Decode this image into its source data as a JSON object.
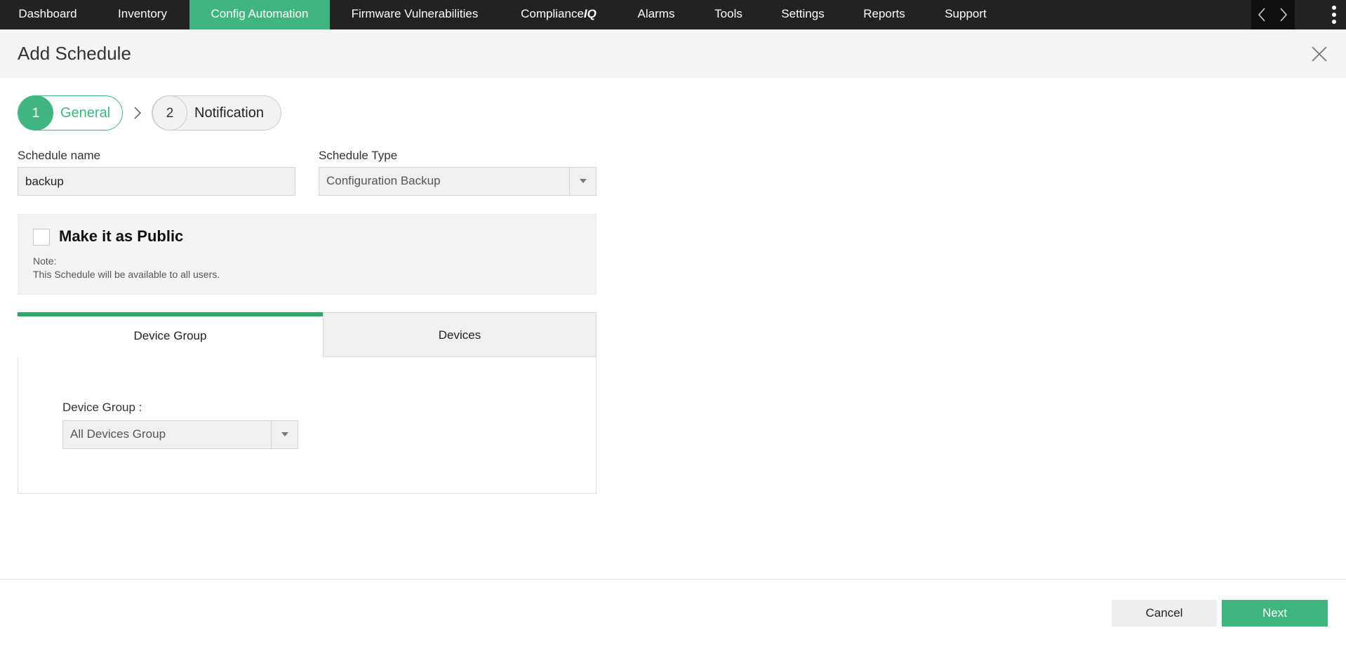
{
  "topnav": {
    "tabs": [
      {
        "label": "Dashboard",
        "active": false
      },
      {
        "label": "Inventory",
        "active": false
      },
      {
        "label": "Config Automation",
        "active": true
      },
      {
        "label": "Firmware Vulnerabilities",
        "active": false
      },
      {
        "label": "Compliance",
        "suffix": "IQ",
        "active": false
      },
      {
        "label": "Alarms",
        "active": false
      },
      {
        "label": "Tools",
        "active": false
      },
      {
        "label": "Settings",
        "active": false
      },
      {
        "label": "Reports",
        "active": false
      },
      {
        "label": "Support",
        "active": false
      }
    ],
    "icons": {
      "prev": "chevron-left-icon",
      "next": "chevron-right-icon",
      "more": "kebab-menu-icon"
    },
    "accent_color": "#41b580",
    "background_color": "#222222"
  },
  "header": {
    "title": "Add Schedule",
    "close_icon": "close-icon"
  },
  "stepper": {
    "steps": [
      {
        "number": "1",
        "label": "General",
        "active": true
      },
      {
        "number": "2",
        "label": "Notification",
        "active": false
      }
    ],
    "separator_icon": "chevron-right-icon"
  },
  "form": {
    "schedule_name": {
      "label": "Schedule name",
      "value": "backup"
    },
    "schedule_type": {
      "label": "Schedule Type",
      "value": "Configuration Backup"
    },
    "public": {
      "label": "Make it as Public",
      "checked": false,
      "note_title": "Note:",
      "note_text": "This Schedule will be available to all users."
    }
  },
  "target_tabs": {
    "tabs": [
      {
        "label": "Device Group",
        "active": true
      },
      {
        "label": "Devices",
        "active": false
      }
    ],
    "device_group": {
      "label": "Device Group :",
      "value": "All Devices Group"
    },
    "active_color": "#2ea867"
  },
  "footer": {
    "cancel_label": "Cancel",
    "next_label": "Next"
  }
}
